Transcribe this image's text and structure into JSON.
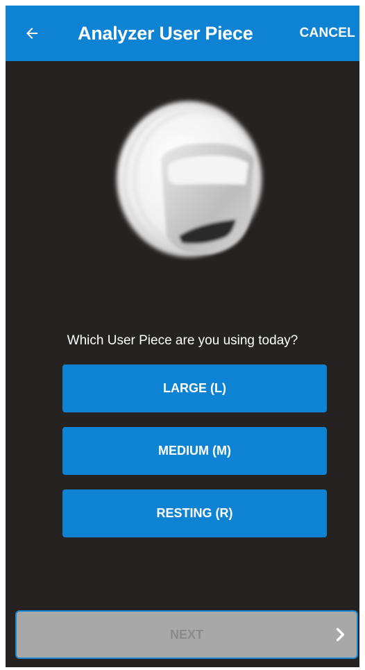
{
  "app_bar": {
    "back_icon": "arrow-left-icon",
    "title": "Analyzer User Piece",
    "cancel_label": "CANCEL"
  },
  "content": {
    "image_subject": "user-piece",
    "question": "Which User Piece are you using today?",
    "options": [
      {
        "label": "LARGE (L)"
      },
      {
        "label": "MEDIUM (M)"
      },
      {
        "label": "RESTING (R)"
      }
    ]
  },
  "footer": {
    "next_label": "NEXT",
    "next_icon": "chevron-right-icon",
    "next_enabled": false
  },
  "colors": {
    "accent": "#0e83d4",
    "background": "#252221",
    "disabled": "#a8a8a8"
  }
}
